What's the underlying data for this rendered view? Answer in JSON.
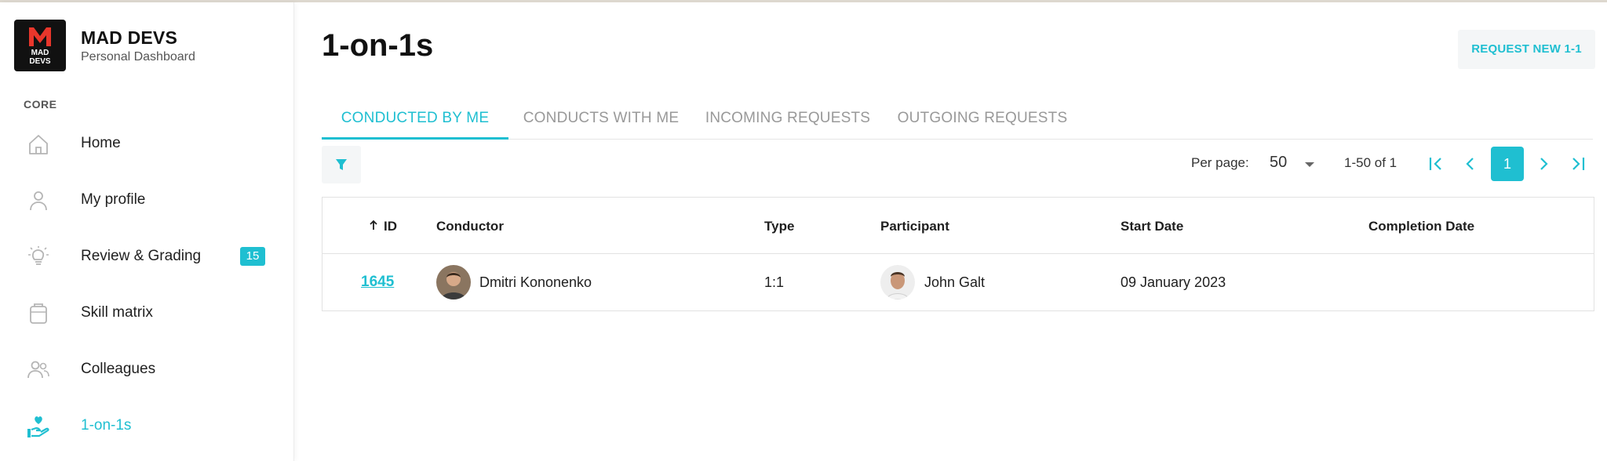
{
  "brand": {
    "title": "MAD DEVS",
    "subtitle": "Personal Dashboard",
    "logo_line1": "MAD",
    "logo_line2": "DEVS"
  },
  "sidebar": {
    "section": "CORE",
    "items": [
      {
        "label": "Home",
        "icon": "home-icon"
      },
      {
        "label": "My profile",
        "icon": "user-icon"
      },
      {
        "label": "Review & Grading",
        "icon": "lightbulb-icon",
        "badge": "15"
      },
      {
        "label": "Skill matrix",
        "icon": "clipboard-icon"
      },
      {
        "label": "Colleagues",
        "icon": "users-icon"
      },
      {
        "label": "1-on-1s",
        "icon": "hand-heart-icon",
        "active": true
      }
    ]
  },
  "main": {
    "title": "1-on-1s",
    "request_button": "REQUEST NEW 1-1",
    "tabs": [
      {
        "label": "CONDUCTED BY ME",
        "active": true
      },
      {
        "label": "CONDUCTS WITH ME"
      },
      {
        "label": "INCOMING REQUESTS"
      },
      {
        "label": "OUTGOING REQUESTS"
      }
    ]
  },
  "pagination": {
    "per_page_label": "Per page:",
    "per_page_value": "50",
    "range": "1-50 of 1",
    "current_page": "1"
  },
  "table": {
    "columns": [
      "ID",
      "Conductor",
      "Type",
      "Participant",
      "Start Date",
      "Completion Date"
    ],
    "rows": [
      {
        "id": "1645",
        "conductor": "Dmitri Kononenko",
        "type": "1:1",
        "participant": "John Galt",
        "start_date": "09 January 2023",
        "completion_date": ""
      }
    ]
  },
  "colors": {
    "accent": "#1fbfd1",
    "text": "#1f1f1f",
    "muted": "#999999",
    "button_bg": "#f4f6f7"
  }
}
